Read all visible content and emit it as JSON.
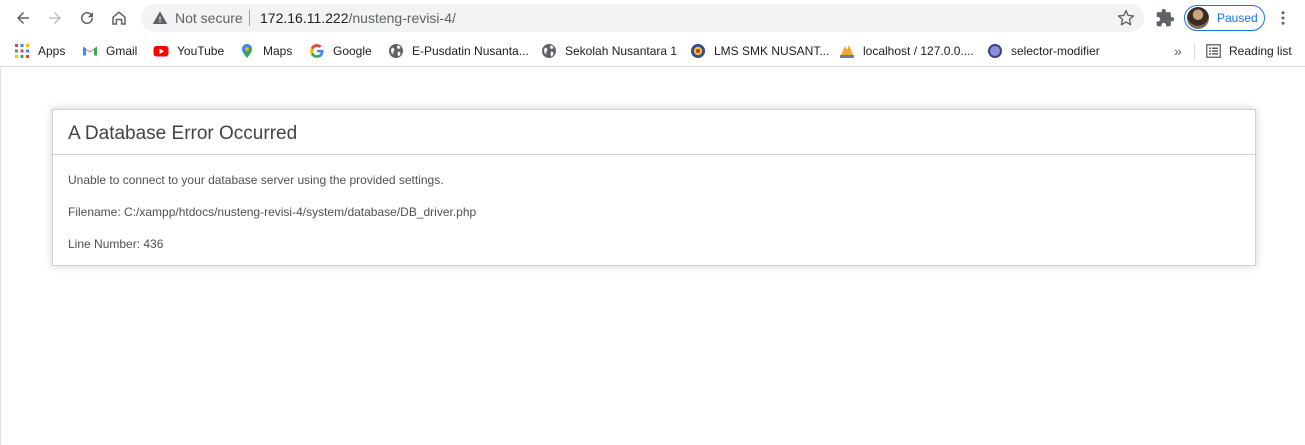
{
  "browser": {
    "nav": {
      "back": "back",
      "forward": "forward",
      "reload": "reload",
      "home": "home"
    },
    "omnibox": {
      "security_label": "Not secure",
      "url_host": "172.16.11.222",
      "url_path": "/nusteng-revisi-4/"
    },
    "profile_label": "Paused",
    "accent_color": "#1a73e8"
  },
  "bookmarks": {
    "items": [
      {
        "label": "Apps",
        "icon": "apps-grid-icon"
      },
      {
        "label": "Gmail",
        "icon": "gmail-icon"
      },
      {
        "label": "YouTube",
        "icon": "youtube-icon"
      },
      {
        "label": "Maps",
        "icon": "maps-icon"
      },
      {
        "label": "Google",
        "icon": "google-icon"
      },
      {
        "label": "E-Pusdatin Nusanta...",
        "icon": "globe-icon"
      },
      {
        "label": "Sekolah Nusantara 1",
        "icon": "globe-icon"
      },
      {
        "label": "LMS SMK NUSANT...",
        "icon": "school-logo-icon"
      },
      {
        "label": "localhost / 127.0.0....",
        "icon": "phpmyadmin-icon"
      },
      {
        "label": "selector-modifier",
        "icon": "circle-icon"
      }
    ],
    "more_label": "»",
    "reading_list_label": "Reading list"
  },
  "error": {
    "title": "A Database Error Occurred",
    "message": "Unable to connect to your database server using the provided settings.",
    "filename_line": "Filename: C:/xampp/htdocs/nusteng-revisi-4/system/database/DB_driver.php",
    "line_number_line": "Line Number: 436"
  }
}
